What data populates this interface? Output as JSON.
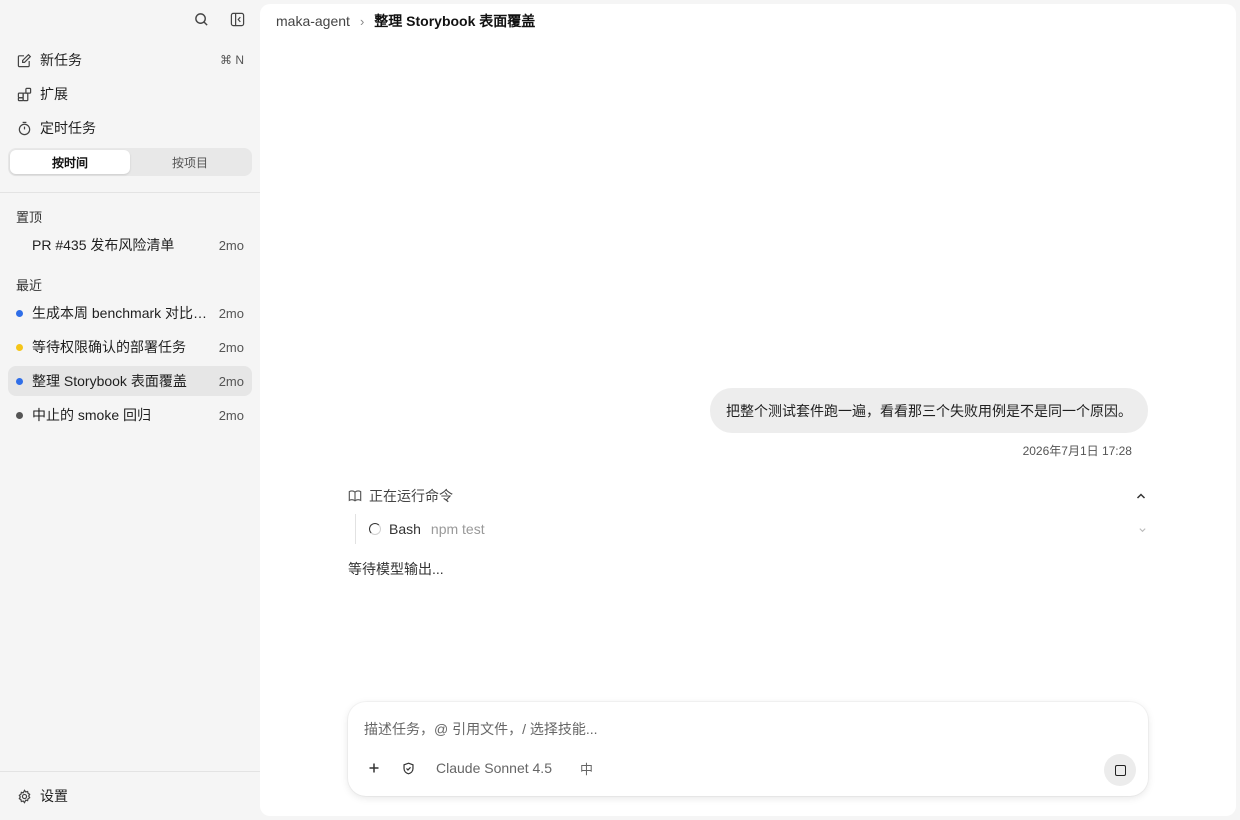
{
  "sidebar": {
    "nav": [
      {
        "label": "新任务",
        "icon": "edit-icon",
        "shortcut": "⌘ N"
      },
      {
        "label": "扩展",
        "icon": "extensions-icon",
        "shortcut": ""
      },
      {
        "label": "定时任务",
        "icon": "timer-icon",
        "shortcut": ""
      }
    ],
    "segments": [
      {
        "label": "按时间",
        "active": true
      },
      {
        "label": "按项目",
        "active": false
      }
    ],
    "pinned_label": "置顶",
    "pinned": [
      {
        "title": "PR #435 发布风险清单",
        "age": "2mo",
        "status": "none"
      }
    ],
    "recent_label": "最近",
    "recent": [
      {
        "title": "生成本周 benchmark 对比报告",
        "age": "2mo",
        "status": "#2f6ee8"
      },
      {
        "title": "等待权限确认的部署任务",
        "age": "2mo",
        "status": "#f5c518"
      },
      {
        "title": "整理 Storybook 表面覆盖",
        "age": "2mo",
        "status": "#2f6ee8"
      },
      {
        "title": "中止的 smoke 回归",
        "age": "2mo",
        "status": "#555555"
      }
    ],
    "settings_label": "设置"
  },
  "breadcrumb": {
    "project": "maka-agent",
    "separator": "›",
    "current": "整理 Storybook 表面覆盖"
  },
  "conversation": {
    "user_message": "把整个测试套件跑一遍，看看那三个失败用例是不是同一个原因。",
    "timestamp": "2026年7月1日 17:28",
    "run_header": "正在运行命令",
    "tool_name": "Bash",
    "tool_command": "npm test",
    "waiting_text": "等待模型输出..."
  },
  "composer": {
    "placeholder": "描述任务，@ 引用文件，/ 选择技能...",
    "model": "Claude Sonnet 4.5",
    "lang": "中"
  },
  "colors": {
    "active_task_bg": "#e6e6e6",
    "blue_dot": "#2f6ee8",
    "yellow_dot": "#f5c518",
    "gray_dot": "#555555"
  }
}
